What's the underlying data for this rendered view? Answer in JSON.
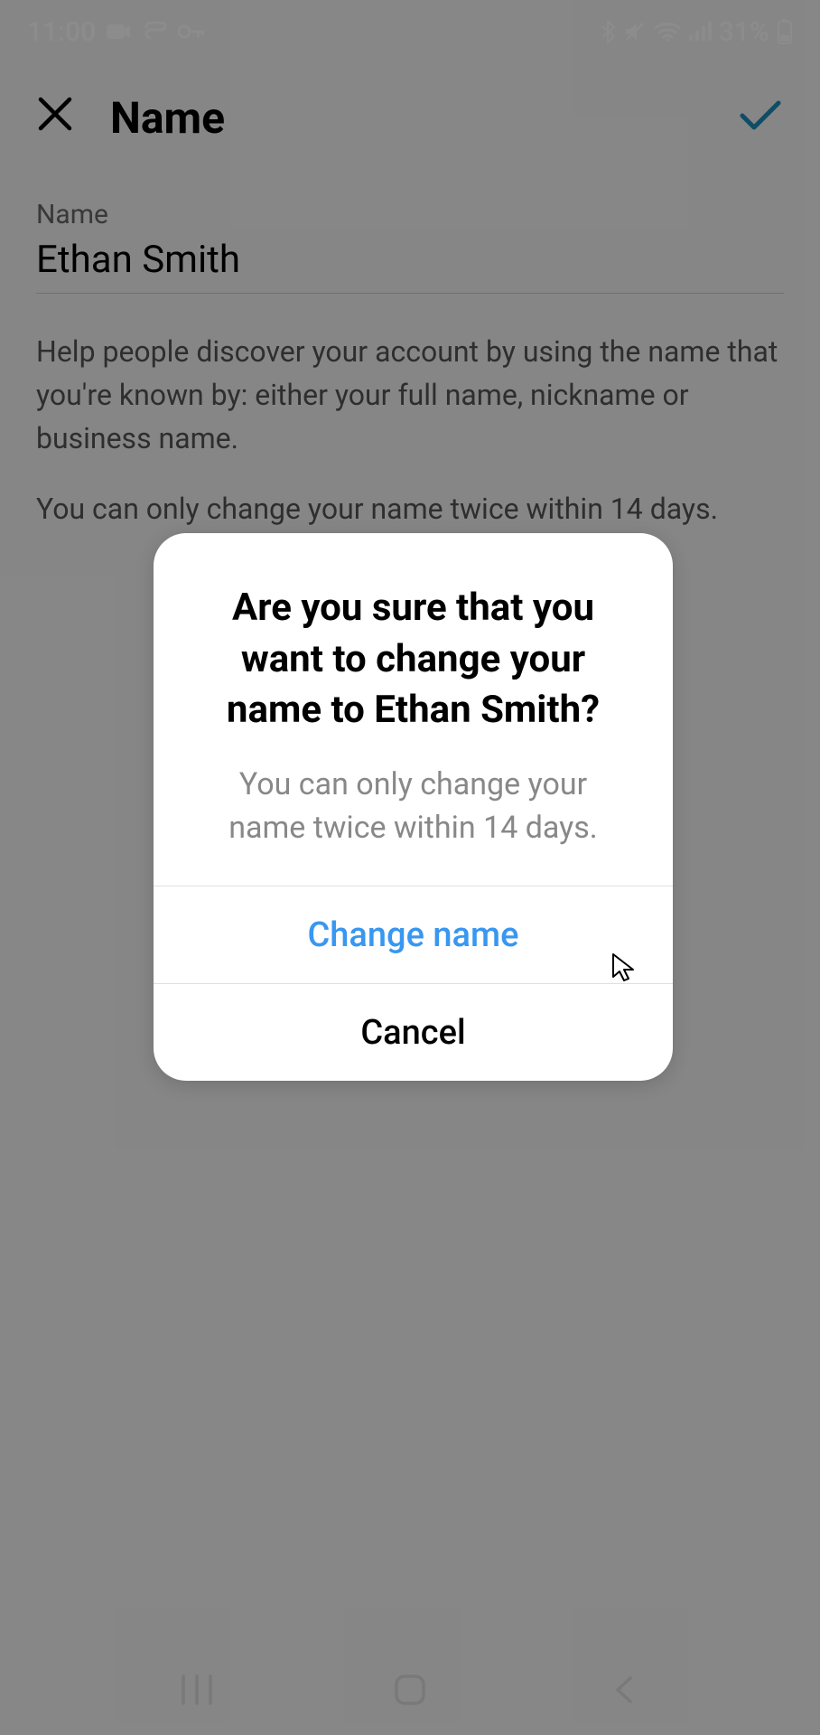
{
  "statusbar": {
    "time": "11:00",
    "battery_pct": "31%"
  },
  "header": {
    "title": "Name"
  },
  "form": {
    "field_label": "Name",
    "field_value": "Ethan Smith",
    "help_1": "Help people discover your account by using the name that you're known by: either your full name, nickname or business name.",
    "help_2": "You can only change your name twice within 14 days."
  },
  "dialog": {
    "title": "Are you sure that you want to change your name to Ethan Smith?",
    "subtitle": "You can only change your name twice within 14 days.",
    "confirm_label": "Change name",
    "cancel_label": "Cancel"
  }
}
